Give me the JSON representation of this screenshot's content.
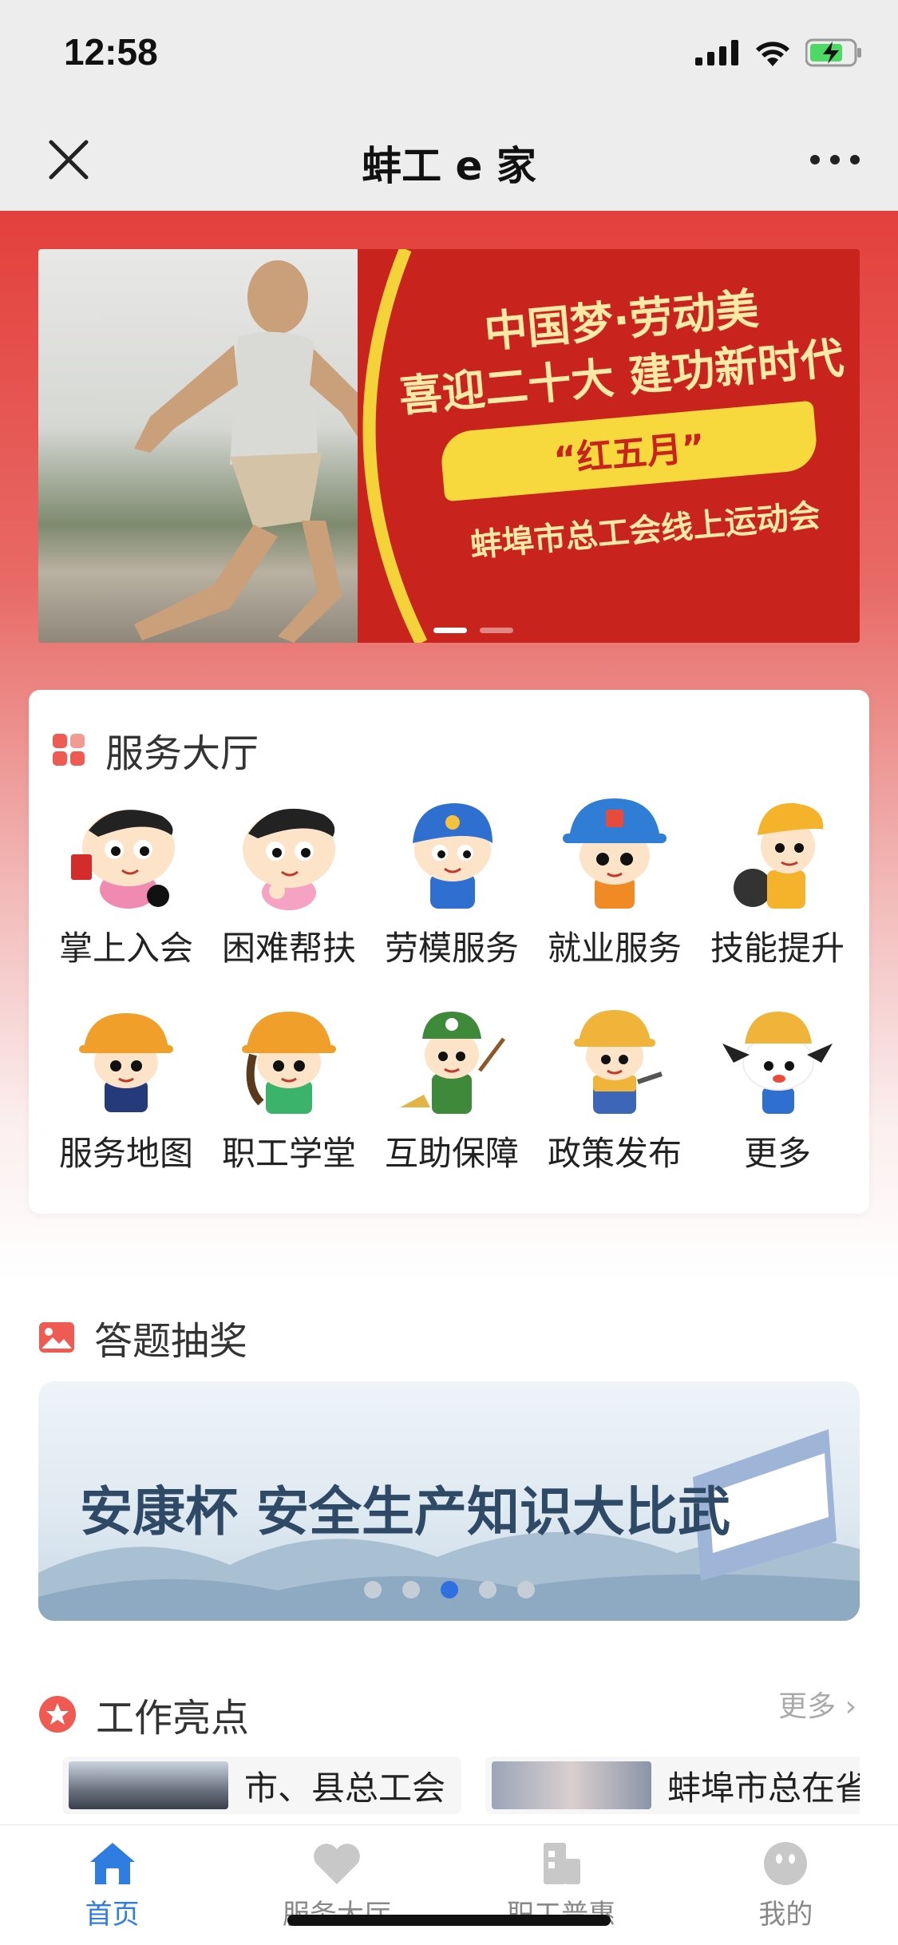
{
  "status_bar": {
    "time": "12:58"
  },
  "title_bar": {
    "title": "蚌工 e 家"
  },
  "banner": {
    "line1": "中国梦·劳动美",
    "line2": "喜迎二十大 建功新时代",
    "line3": "“红五月”",
    "line4": "蚌埠市总工会线上运动会",
    "dots": 2,
    "active_dot": 0
  },
  "service_hall": {
    "title": "服务大厅",
    "items": [
      {
        "label": "掌上入会",
        "icon": "cartoon-join-icon"
      },
      {
        "label": "困难帮扶",
        "icon": "cartoon-help-icon"
      },
      {
        "label": "劳模服务",
        "icon": "cartoon-model-worker-icon"
      },
      {
        "label": "就业服务",
        "icon": "cartoon-employment-icon"
      },
      {
        "label": "技能提升",
        "icon": "cartoon-skill-icon"
      },
      {
        "label": "服务地图",
        "icon": "cartoon-map-icon"
      },
      {
        "label": "职工学堂",
        "icon": "cartoon-school-icon"
      },
      {
        "label": "互助保障",
        "icon": "cartoon-mutual-aid-icon"
      },
      {
        "label": "政策发布",
        "icon": "cartoon-policy-icon"
      },
      {
        "label": "更多",
        "icon": "cartoon-more-icon"
      }
    ]
  },
  "quiz": {
    "title": "答题抽奖",
    "banner_text": "安康杯 安全生产知识大比武",
    "dots": 5,
    "active_dot": 2
  },
  "highlights": {
    "title": "工作亮点",
    "more": "更多 ›",
    "items": [
      {
        "text": "市、县总工会"
      },
      {
        "text": "蚌埠市总在省"
      }
    ]
  },
  "tab_bar": {
    "tabs": [
      {
        "label": "首页",
        "active": true
      },
      {
        "label": "服务大厅",
        "active": false
      },
      {
        "label": "职工普惠",
        "active": false
      },
      {
        "label": "我的",
        "active": false
      }
    ]
  },
  "colors": {
    "accent_red": "#e3403c",
    "tab_active": "#2f7de0",
    "tab_inactive": "#888888"
  }
}
